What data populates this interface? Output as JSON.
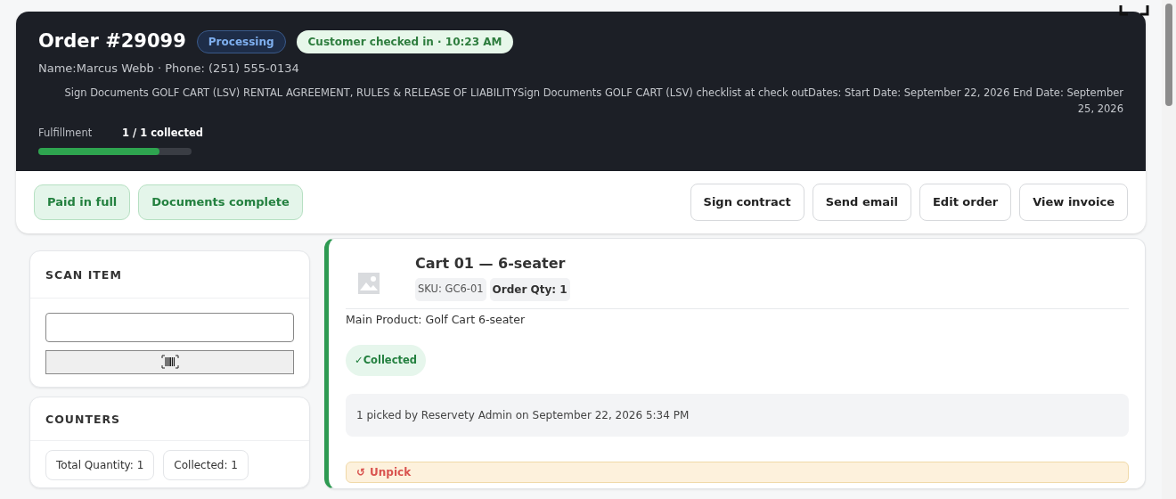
{
  "order": {
    "title": "Order #29099",
    "status_badge": "Processing",
    "checkin_badge": "Customer checked in · 10:23 AM",
    "customer_line": "Name:Marcus Webb · Phone: (251) 555-0134",
    "details": "Sign Documents GOLF CART (LSV) RENTAL AGREEMENT, RULES & RELEASE OF LIABILITYSign Documents GOLF CART (LSV) checklist at check outDates:  Start Date: September 22, 2026  End Date: September 25, 2026",
    "fulfillment": {
      "label": "Fulfillment",
      "reading": "1 / 1 collected",
      "level": 0.79
    }
  },
  "status_chips": [
    "Paid in full",
    "Documents complete"
  ],
  "actions": [
    "Sign contract",
    "Send email",
    "Edit order",
    "View invoice"
  ],
  "scan_panel": {
    "title": "SCAN ITEM"
  },
  "counters_panel": {
    "title": "COUNTERS",
    "chips": [
      "Total Quantity: 1",
      "Collected: 1"
    ]
  },
  "item": {
    "name": "Cart 01 — 6-seater",
    "sku": "SKU: GC6-01",
    "qty": "Order Qty: 1",
    "main_product": "Main Product: Golf Cart 6-seater",
    "collected": true,
    "collected_label": "✓Collected",
    "pick_log": "1 picked by Reservety Admin on September 22, 2026 5:34 PM",
    "unpick_icon": "↺",
    "unpick_label": "Unpick"
  }
}
